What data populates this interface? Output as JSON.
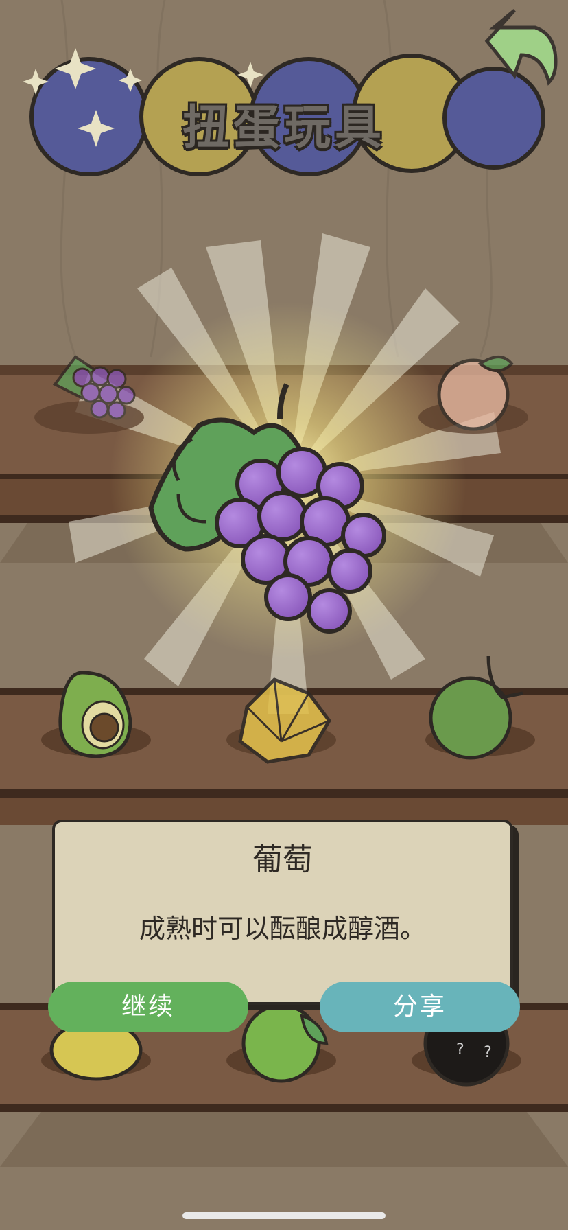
{
  "header": {
    "title": "扭蛋玩具"
  },
  "nav": {
    "back_icon": "back-arrow-icon"
  },
  "prize": {
    "name": "葡萄",
    "description": "成熟时可以酝酿成醇酒。",
    "icon": "grape-icon"
  },
  "buttons": {
    "continue_label": "继续",
    "share_label": "分享"
  },
  "shelf_items": [
    {
      "row": 1,
      "icon": "grape-icon"
    },
    {
      "row": 1,
      "icon": "peach-icon"
    },
    {
      "row": 2,
      "icon": "avocado-icon"
    },
    {
      "row": 2,
      "icon": "starfruit-icon"
    },
    {
      "row": 2,
      "icon": "coconut-icon"
    },
    {
      "row": 3,
      "icon": "lemon-icon"
    },
    {
      "row": 3,
      "icon": "lime-icon"
    },
    {
      "row": 3,
      "icon": "mystery-fruit-icon"
    }
  ],
  "colors": {
    "continue_button": "#63b15c",
    "share_button": "#68b4ba",
    "card_background": "#dcd3b8",
    "wall": "#8a7a66",
    "shelf": "#6a4a34",
    "grape": "#9a68c8",
    "leaf": "#5fa15a"
  }
}
